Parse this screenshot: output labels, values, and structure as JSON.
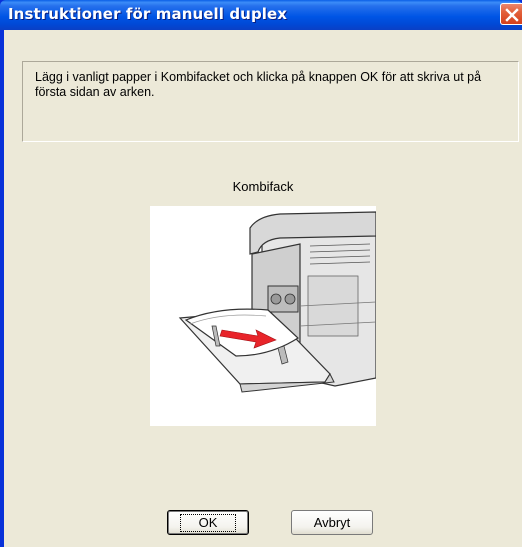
{
  "window": {
    "title": "Instruktioner för manuell duplex",
    "close_icon": "close-icon"
  },
  "instructions": {
    "text": "Lägg i vanligt papper i Kombifacket och klicka på knappen OK för att skriva ut på första sidan av arken."
  },
  "illustration": {
    "label": "Kombifack",
    "icon": "printer-paper-feed-illustration"
  },
  "buttons": {
    "ok_label": "OK",
    "cancel_label": "Avbryt"
  },
  "colors": {
    "titlebar": "#0055e5",
    "client_bg": "#ece9d8",
    "close_button": "#e3613b",
    "arrow": "#e8242a"
  }
}
